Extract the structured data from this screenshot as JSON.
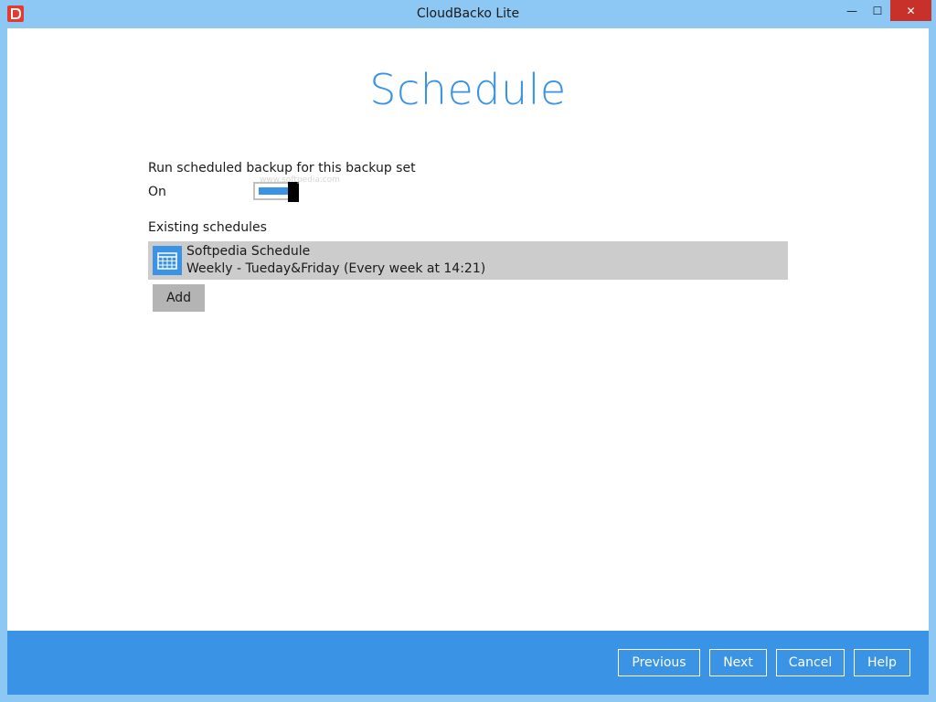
{
  "window": {
    "title": "CloudBacko Lite",
    "minimize_symbol": "—",
    "maximize_symbol": "☐",
    "close_symbol": "✕",
    "close_color": "#c7312a"
  },
  "page": {
    "heading": "Schedule",
    "run_scheduled_label": "Run scheduled backup for this backup set",
    "toggle_state_label": "On",
    "toggle_on": true,
    "existing_schedules_label": "Existing schedules",
    "schedules": [
      {
        "name": "Softpedia Schedule",
        "description": "Weekly - Tueday&Friday (Every week at 14:21)",
        "icon": "calendar-icon"
      }
    ],
    "add_label": "Add",
    "watermark": "www.softpedia.com"
  },
  "footer": {
    "previous_label": "Previous",
    "next_label": "Next",
    "cancel_label": "Cancel",
    "help_label": "Help"
  },
  "colors": {
    "accent": "#3a93e4",
    "title_bar": "#8cc8f3",
    "selected_row": "#cccccc"
  }
}
